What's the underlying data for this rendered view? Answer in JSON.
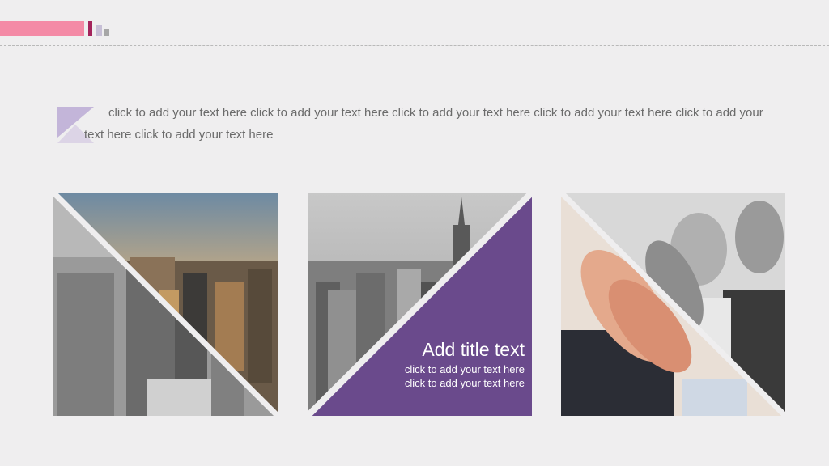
{
  "body_text": "click to add your text here click to add your text here click to add your text here click to add your text here click to add your text here click to add your text here",
  "caption": {
    "title": "Add title text",
    "body": "click to add your text here click to add your text here"
  },
  "colors": {
    "accent_pink": "#f48aa6",
    "accent_magenta": "#a4245c",
    "accent_purple": "#6a4a8c",
    "background": "#efeeef"
  },
  "images": [
    "city-skyline-split-photo",
    "city-skyline-purple-overlay-photo",
    "clapping-hands-photo"
  ]
}
